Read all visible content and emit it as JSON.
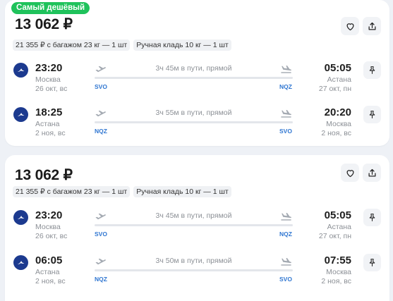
{
  "cards": [
    {
      "badge": "Самый дешёвый",
      "price": "13 062 ₽",
      "chips": [
        "21 355 ₽ с багажом 23 кг — 1 шт",
        "Ручная кладь 10 кг — 1 шт"
      ],
      "segments": [
        {
          "dep_time": "23:20",
          "dep_city": "Москва",
          "dep_date": "26 окт, вс",
          "duration": "3ч 45м в пути, прямой",
          "arr_time": "05:05",
          "arr_city": "Астана",
          "arr_date": "27 окт, пн",
          "dep_code": "SVO",
          "arr_code": "NQZ"
        },
        {
          "dep_time": "18:25",
          "dep_city": "Астана",
          "dep_date": "2 ноя, вс",
          "duration": "3ч 55м в пути, прямой",
          "arr_time": "20:20",
          "arr_city": "Москва",
          "arr_date": "2 ноя, вс",
          "dep_code": "NQZ",
          "arr_code": "SVO"
        }
      ]
    },
    {
      "price": "13 062 ₽",
      "chips": [
        "21 355 ₽ с багажом 23 кг — 1 шт",
        "Ручная кладь 10 кг — 1 шт"
      ],
      "segments": [
        {
          "dep_time": "23:20",
          "dep_city": "Москва",
          "dep_date": "26 окт, вс",
          "duration": "3ч 45м в пути, прямой",
          "arr_time": "05:05",
          "arr_city": "Астана",
          "arr_date": "27 окт, пн",
          "dep_code": "SVO",
          "arr_code": "NQZ"
        },
        {
          "dep_time": "06:05",
          "dep_city": "Астана",
          "dep_date": "2 ноя, вс",
          "duration": "3ч 50м в пути, прямой",
          "arr_time": "07:55",
          "arr_city": "Москва",
          "arr_date": "2 ноя, вс",
          "dep_code": "NQZ",
          "arr_code": "SVO"
        }
      ]
    }
  ],
  "icons": {
    "favorite": "heart-icon",
    "share": "share-icon",
    "pin": "pin-icon",
    "airline": "airline-logo",
    "departure": "plane-takeoff-icon",
    "arrival": "plane-landing-icon"
  },
  "colors": {
    "badge": "#1fc25b",
    "airport_code": "#2f76d1",
    "airline_logo": "#1c3a8f",
    "page_background": "#eef1f6"
  }
}
